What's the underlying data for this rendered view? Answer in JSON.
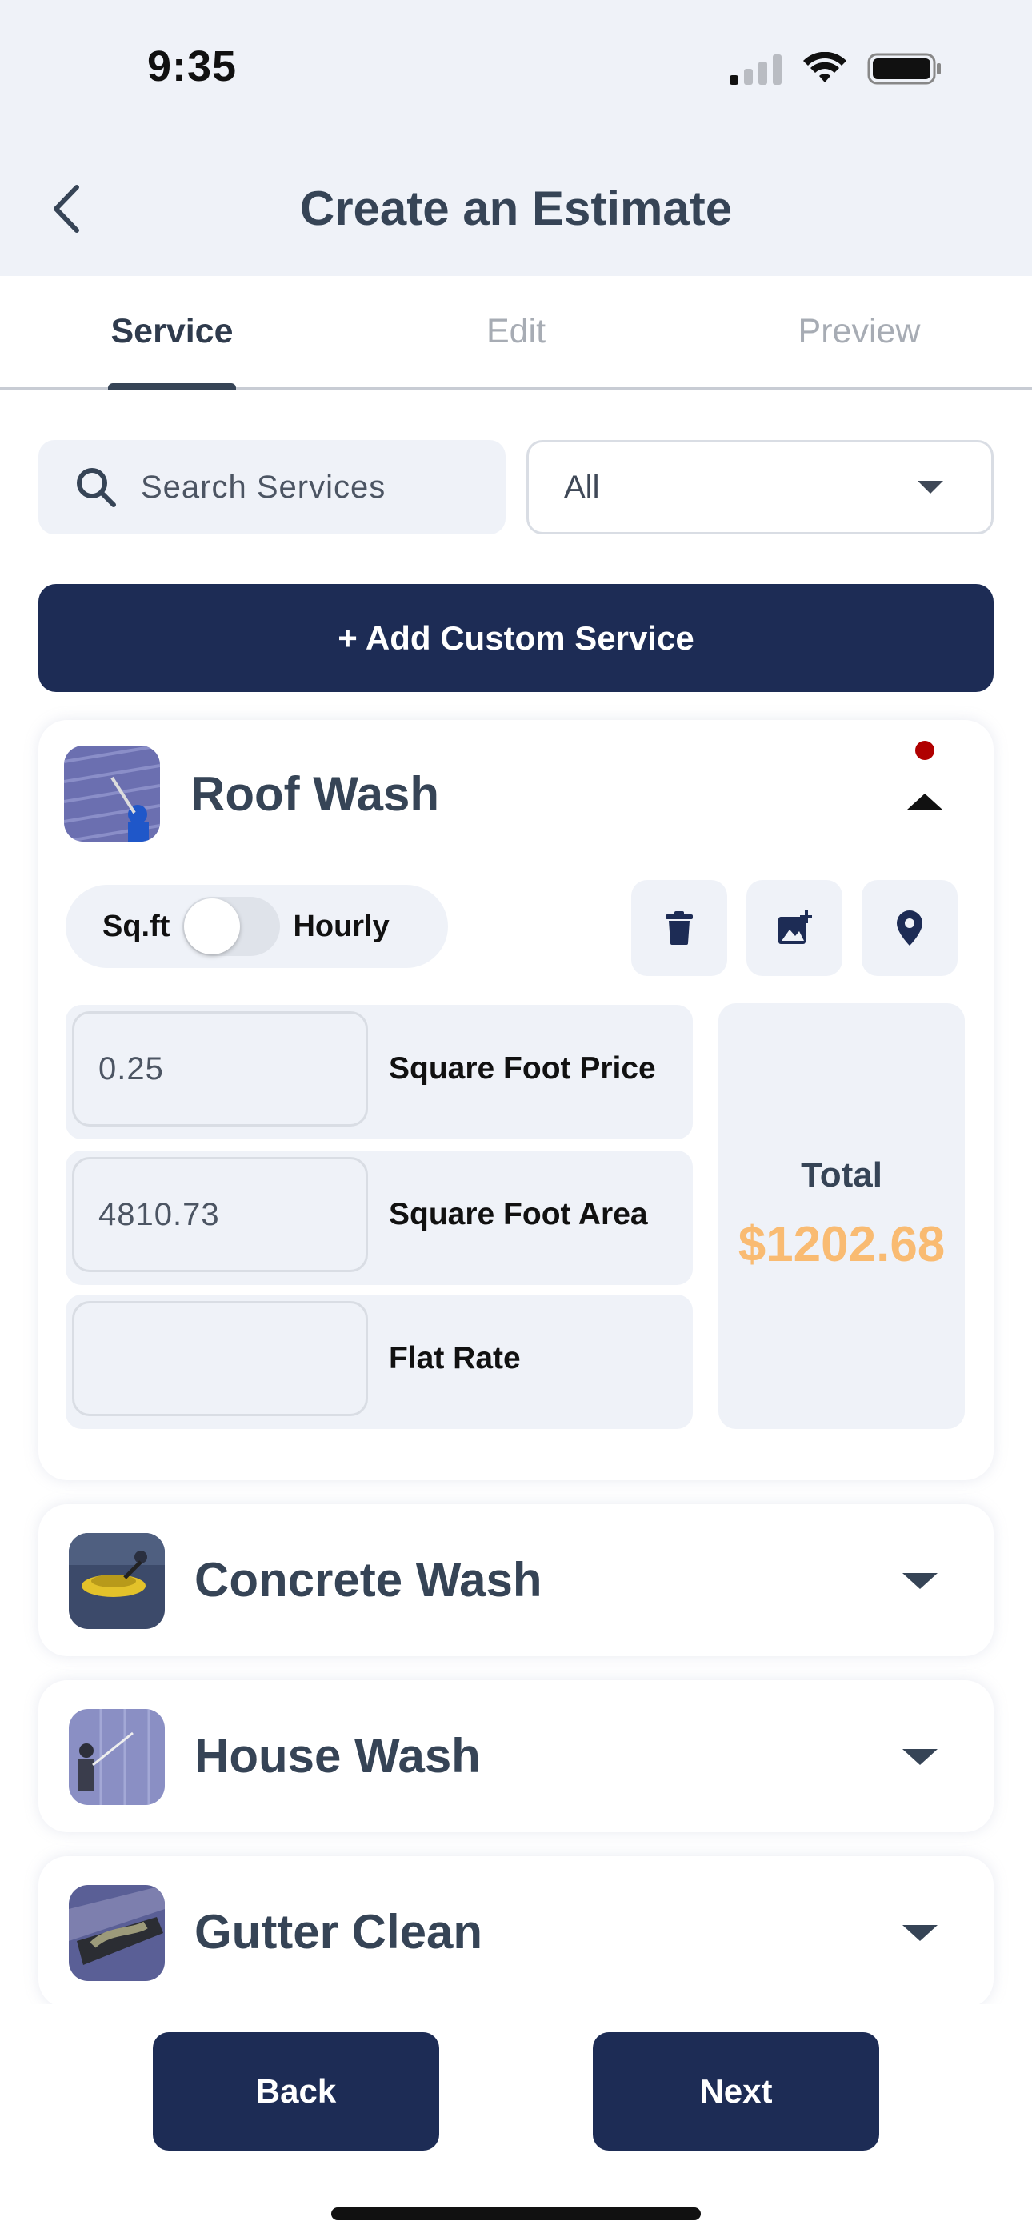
{
  "status_bar": {
    "time": "9:35"
  },
  "header": {
    "title": "Create an Estimate"
  },
  "tabs": [
    {
      "label": "Service",
      "active": true
    },
    {
      "label": "Edit",
      "active": false
    },
    {
      "label": "Preview",
      "active": false
    }
  ],
  "search": {
    "placeholder": "Search Services"
  },
  "filter": {
    "selected": "All"
  },
  "add_custom_label": "+ Add Custom Service",
  "services": [
    {
      "name": "Roof Wash",
      "expanded": true,
      "toggle": {
        "left_label": "Sq.ft",
        "right_label": "Hourly",
        "on": false
      },
      "fields": [
        {
          "value": "0.25",
          "label": "Square Foot Price"
        },
        {
          "value": "4810.73",
          "label": "Square Foot Area"
        },
        {
          "value": "",
          "label": "Flat Rate"
        }
      ],
      "total_label": "Total",
      "total_value": "$1202.68"
    },
    {
      "name": "Concrete Wash",
      "expanded": false
    },
    {
      "name": "House Wash",
      "expanded": false
    },
    {
      "name": "Gutter Clean",
      "expanded": false
    }
  ],
  "bottom": {
    "back_label": "Back",
    "next_label": "Next"
  },
  "colors": {
    "primary": "#1d2c55",
    "accent_total": "#f9bb72",
    "surface": "#eff2f8",
    "text": "#364456"
  }
}
